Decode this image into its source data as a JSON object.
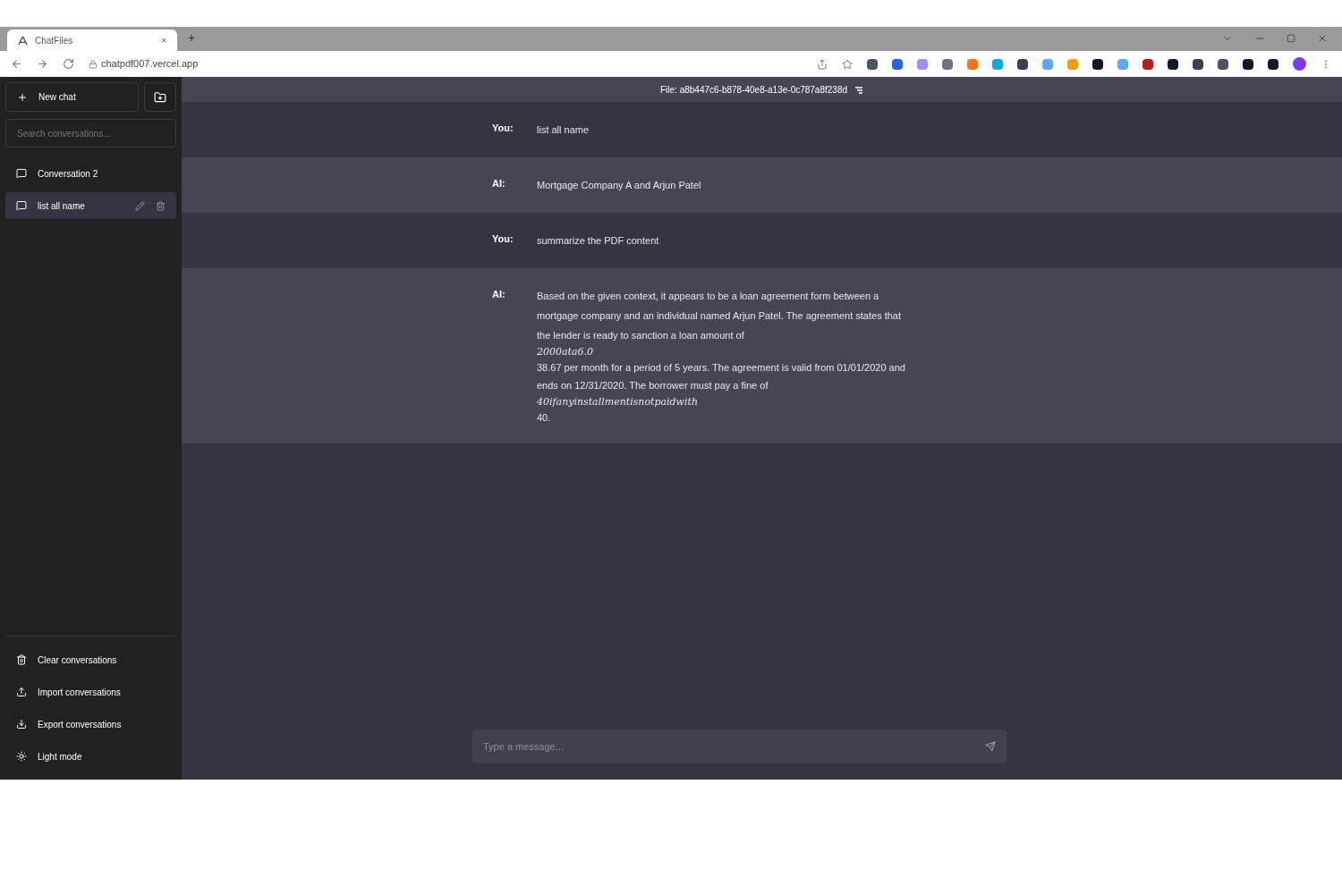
{
  "browser": {
    "tab_title": "ChatFiles",
    "tab_close": "×",
    "new_tab": "+",
    "url": "chatpdf007.vercel.app"
  },
  "sidebar": {
    "new_chat": "New chat",
    "search": {
      "placeholder": "Search conversations..."
    },
    "conversations": [
      {
        "title": "Conversation 2",
        "selected": false
      },
      {
        "title": "list all name",
        "selected": true
      }
    ],
    "footer": [
      "Clear conversations",
      "Import conversations",
      "Export conversations",
      "Light mode"
    ]
  },
  "chat": {
    "file": "File: a8b447c6-b878-40e8-a13e-0c787a8f238d",
    "messages": [
      {
        "kind": "user",
        "speaker": "You:",
        "lines": [
          {
            "kind": "text",
            "text": "list all name"
          }
        ]
      },
      {
        "kind": "ai",
        "speaker": "AI:",
        "lines": [
          {
            "kind": "text",
            "text": "Mortgage Company A and Arjun Patel"
          }
        ]
      },
      {
        "kind": "user",
        "speaker": "You:",
        "lines": [
          {
            "kind": "text",
            "text": "summarize the PDF content"
          }
        ]
      },
      {
        "kind": "ai",
        "speaker": "AI:",
        "lines": [
          {
            "kind": "text",
            "text": "Based on the given context, it appears to be a loan agreement form between a"
          },
          {
            "kind": "text",
            "text": "mortgage company and an individual named Arjun Patel. The agreement states that"
          },
          {
            "kind": "text",
            "text": "the lender is ready to sanction a loan amount of"
          },
          {
            "kind": "math",
            "text": "2000ata6.0"
          },
          {
            "kind": "text",
            "text": "38.67 per month for a period of 5 years. The agreement is valid from 01/01/2020 and"
          },
          {
            "kind": "text",
            "text": "ends on 12/31/2020. The borrower must pay a fine of"
          },
          {
            "kind": "math",
            "text": "40ifanyinstallmentisnotpaidwith"
          },
          {
            "kind": "text",
            "text": "40."
          }
        ]
      }
    ],
    "input": {
      "placeholder": "Type a message..."
    }
  }
}
